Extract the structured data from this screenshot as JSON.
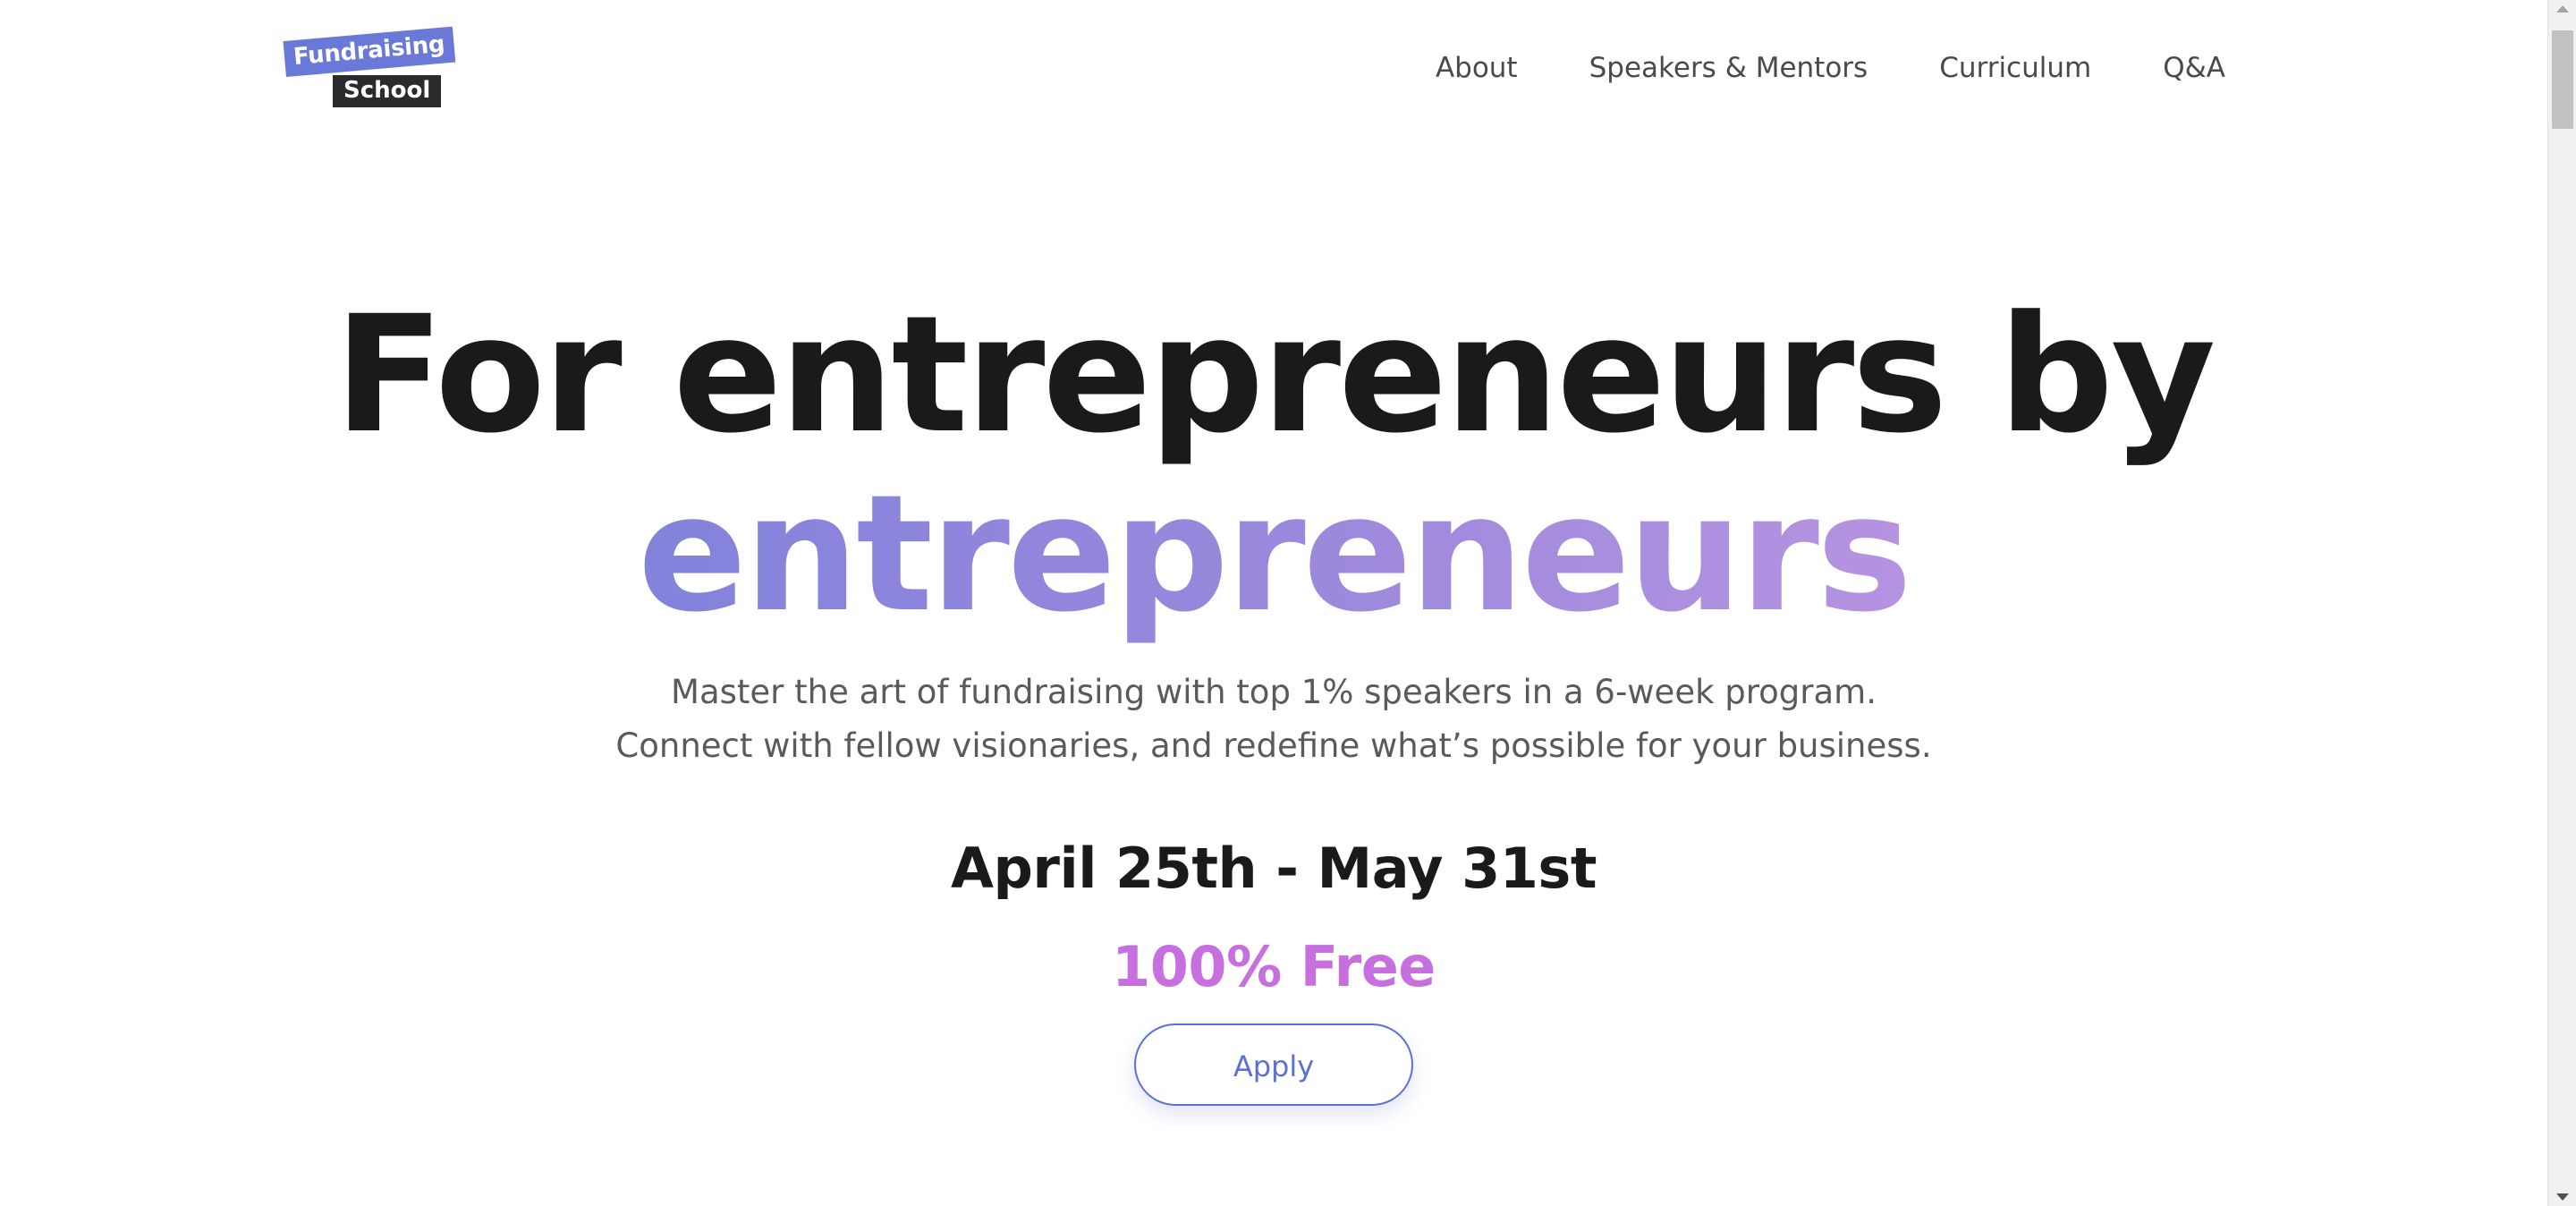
{
  "logo": {
    "line1": "Fundraising",
    "line2": "School"
  },
  "nav": {
    "items": [
      "About",
      "Speakers & Mentors",
      "Curriculum",
      "Q&A"
    ]
  },
  "hero": {
    "title_line1": "For entrepreneurs by",
    "title_line2": "entrepreneurs",
    "subtitle": "Master the art of fundraising with top 1% speakers in a 6-week program. Connect with fellow visionaries, and redefine what’s possible for your business.",
    "dates": "April 25th - May 31st",
    "price": "100% Free",
    "apply_label": "Apply"
  },
  "colors": {
    "accent_blue": "#5c6fd6",
    "accent_purple": "#c86fe0",
    "gradient_start": "#6a7ddc",
    "gradient_end": "#d29ee6",
    "logo_blue": "#6a78d8",
    "logo_dark": "#2b2b2e",
    "text_dark": "#1a1a1a"
  }
}
